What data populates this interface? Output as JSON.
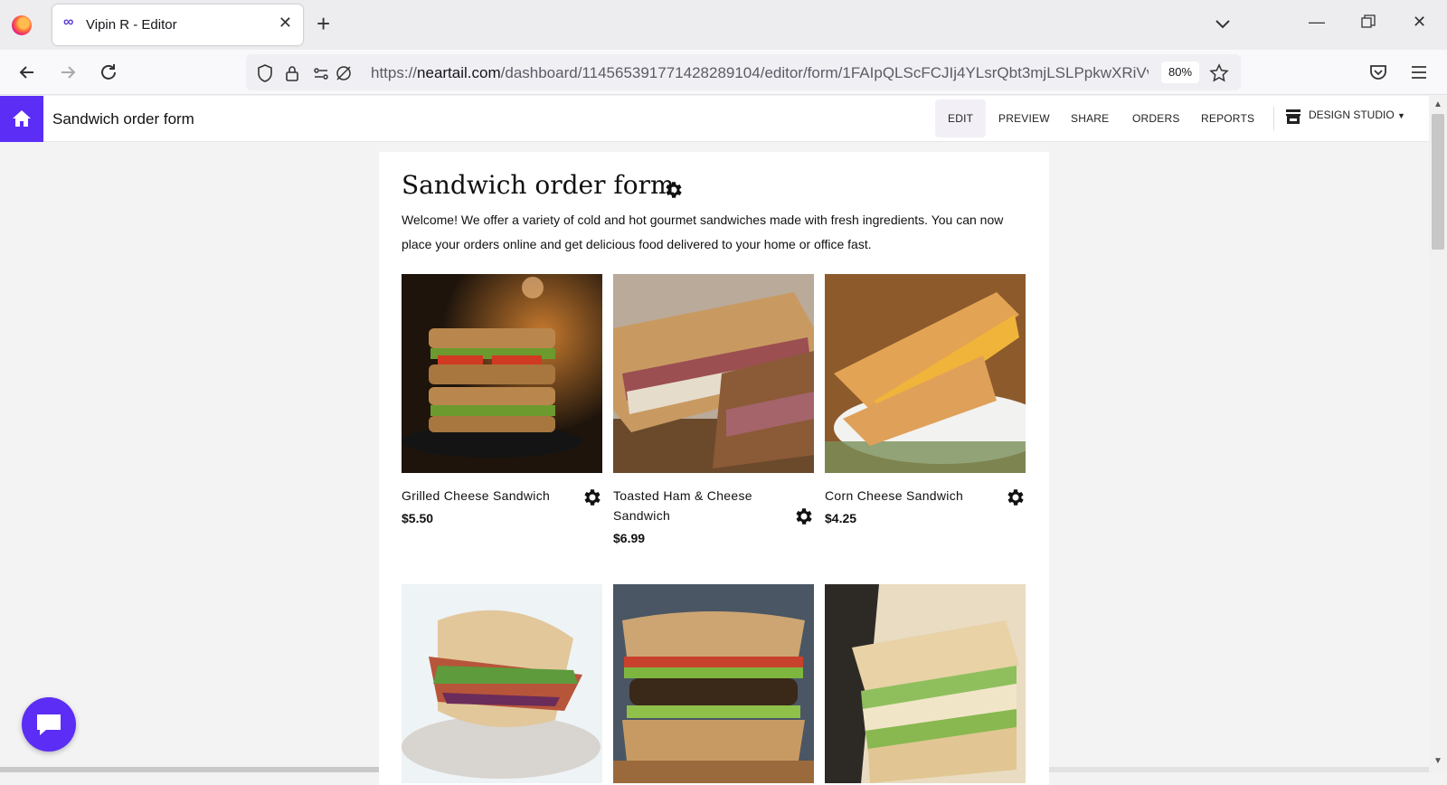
{
  "browser": {
    "tab_title": "Vipin R - Editor",
    "url_prefix": "https://",
    "url_domain": "neartail.com",
    "url_path": "/dashboard/11456539177142828910​4/editor/form/1FAIpQLScFCJIj4YLsrQbt3mjLSLPpkwXRiVv",
    "zoom": "80%"
  },
  "app": {
    "title": "Sandwich order form",
    "menu": [
      "EDIT",
      "PREVIEW",
      "SHARE",
      "ORDERS",
      "REPORTS"
    ],
    "design_studio": "DESIGN STUDIO"
  },
  "form": {
    "title": "Sandwich order form",
    "description": "Welcome! We offer a variety of cold and hot gourmet sandwiches made with fresh ingredients. You can now place your orders online and get delicious food delivered to your home or office fast.",
    "products": [
      {
        "name": "Grilled Cheese Sandwich",
        "price": "$5.50"
      },
      {
        "name": "Toasted Ham & Cheese Sandwich",
        "price": "$6.99"
      },
      {
        "name": "Corn Cheese Sandwich",
        "price": "$4.25"
      }
    ]
  },
  "colors": {
    "brand": "#5b2df5"
  }
}
